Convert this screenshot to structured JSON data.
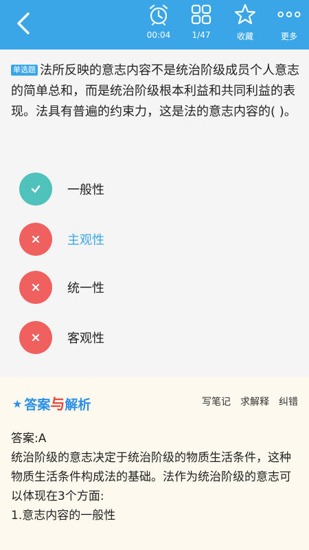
{
  "header": {
    "timer_label": "00:04",
    "progress_label": "1/47",
    "favorite_label": "收藏",
    "more_label": "更多"
  },
  "question": {
    "type_badge": "单选题",
    "text": "法所反映的意志内容不是统治阶级成员个人意志的简单总和，而是统治阶级根本利益和共同利益的表现。法具有普遍的约束力，这是法的意志内容的(    )。",
    "options": [
      {
        "label": "一般性",
        "status": "correct"
      },
      {
        "label": "主观性",
        "status": "wrong"
      },
      {
        "label": "统一性",
        "status": "wrong"
      },
      {
        "label": "客观性",
        "status": "wrong"
      }
    ]
  },
  "analysis": {
    "title_prefix": "答案",
    "title_mid": "与",
    "title_suffix": "解析",
    "actions": {
      "write_note": "写笔记",
      "ask_explain": "求解释",
      "report_error": "纠错"
    },
    "answer_line": "答案:A",
    "body_line_1": "统治阶级的意志决定于统治阶级的物质生活条件，这种物质生活条件构成法的基础。法作为统治阶级的意志可以体现在3个方面:",
    "body_line_2": "1.意志内容的一般性"
  },
  "colors": {
    "accent": "#3aa6e8",
    "correct": "#4fc2bb",
    "wrong": "#f0605e",
    "analysis_bg": "#fdf9ef"
  }
}
